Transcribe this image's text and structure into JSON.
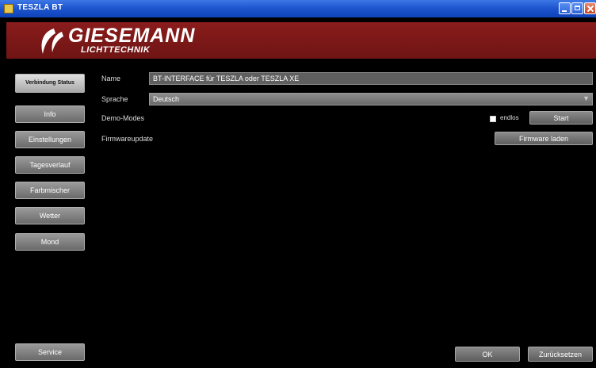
{
  "window": {
    "title": "TESZLA BT"
  },
  "brand": {
    "name": "GIESEMANN",
    "sub": "LICHTTECHNIK",
    "accent": "#7a1818"
  },
  "sidebar": {
    "items": [
      {
        "label": "Verbindung Status"
      },
      {
        "label": "Info"
      },
      {
        "label": "Einstellungen"
      },
      {
        "label": "Tagesverlauf"
      },
      {
        "label": "Farbmischer"
      },
      {
        "label": "Wetter"
      },
      {
        "label": "Mond"
      }
    ],
    "service_label": "Service"
  },
  "form": {
    "name_label": "Name",
    "name_value": "BT-INTERFACE für TESZLA oder TESZLA XE",
    "language_label": "Sprache",
    "language_value": "Deutsch",
    "demo_label": "Demo-Modes",
    "endless_label": "endlos",
    "start_label": "Start",
    "firmware_label": "Firmwareupdate",
    "firmware_button": "Firmware laden"
  },
  "footer": {
    "ok_label": "OK",
    "reset_label": "Zurücksetzen"
  }
}
